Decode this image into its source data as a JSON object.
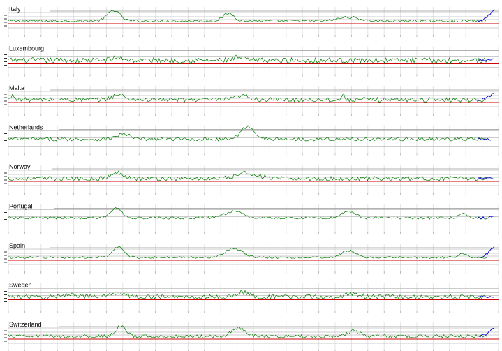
{
  "chart_data": {
    "type": "line",
    "layout": "small-multiples",
    "grid": true,
    "baseline_color": "#cc0000",
    "series_color": "#007a00",
    "forecast_color": "#0000cc",
    "reference_color": "#000000",
    "panels": [
      {
        "name": "Italy",
        "peaks": [
          {
            "at": 0.22,
            "h": 0.85,
            "w": 0.018
          },
          {
            "at": 0.46,
            "h": 0.6,
            "w": 0.016
          },
          {
            "at": 0.71,
            "h": 0.3,
            "w": 0.03
          }
        ],
        "noise": 0.1,
        "forecast_end": 1.0
      },
      {
        "name": "Luxembourg",
        "peaks": [
          {
            "at": 0.23,
            "h": 0.25,
            "w": 0.015
          },
          {
            "at": 0.48,
            "h": 0.22,
            "w": 0.015
          }
        ],
        "noise": 0.22,
        "forecast_end": 0.15
      },
      {
        "name": "Malta",
        "peaks": [
          {
            "at": 0.01,
            "h": 0.35,
            "w": 0.006
          },
          {
            "at": 0.23,
            "h": 0.4,
            "w": 0.018
          },
          {
            "at": 0.49,
            "h": 0.3,
            "w": 0.02
          },
          {
            "at": 0.7,
            "h": 0.35,
            "w": 0.005
          }
        ],
        "noise": 0.18,
        "forecast_end": 0.55
      },
      {
        "name": "Netherlands",
        "peaks": [
          {
            "at": 0.24,
            "h": 0.4,
            "w": 0.02
          },
          {
            "at": 0.5,
            "h": 1.0,
            "w": 0.02
          }
        ],
        "noise": 0.14,
        "forecast_end": 0.0
      },
      {
        "name": "Norway",
        "peaks": [
          {
            "at": 0.23,
            "h": 0.45,
            "w": 0.02
          },
          {
            "at": 0.5,
            "h": 0.45,
            "w": 0.03
          }
        ],
        "noise": 0.18,
        "forecast_end": 0.0
      },
      {
        "name": "Portugal",
        "peaks": [
          {
            "at": 0.225,
            "h": 0.8,
            "w": 0.016
          },
          {
            "at": 0.47,
            "h": 0.55,
            "w": 0.025
          },
          {
            "at": 0.71,
            "h": 0.55,
            "w": 0.02
          },
          {
            "at": 0.95,
            "h": 0.3,
            "w": 0.012
          }
        ],
        "noise": 0.1,
        "forecast_end": 0.15
      },
      {
        "name": "Spain",
        "peaks": [
          {
            "at": 0.23,
            "h": 0.85,
            "w": 0.016
          },
          {
            "at": 0.47,
            "h": 0.75,
            "w": 0.025
          },
          {
            "at": 0.71,
            "h": 0.55,
            "w": 0.02
          },
          {
            "at": 0.95,
            "h": 0.3,
            "w": 0.012
          }
        ],
        "noise": 0.08,
        "forecast_end": 0.95
      },
      {
        "name": "Sweden",
        "peaks": [
          {
            "at": 0.13,
            "h": 0.25,
            "w": 0.02
          },
          {
            "at": 0.23,
            "h": 0.35,
            "w": 0.02
          },
          {
            "at": 0.49,
            "h": 0.35,
            "w": 0.02
          },
          {
            "at": 0.72,
            "h": 0.25,
            "w": 0.02
          }
        ],
        "noise": 0.18,
        "forecast_end": 0.0
      },
      {
        "name": "Switzerland",
        "peaks": [
          {
            "at": 0.235,
            "h": 0.8,
            "w": 0.015
          },
          {
            "at": 0.48,
            "h": 0.7,
            "w": 0.02
          },
          {
            "at": 0.72,
            "h": 0.4,
            "w": 0.02
          }
        ],
        "noise": 0.14,
        "forecast_end": 0.7
      }
    ]
  }
}
